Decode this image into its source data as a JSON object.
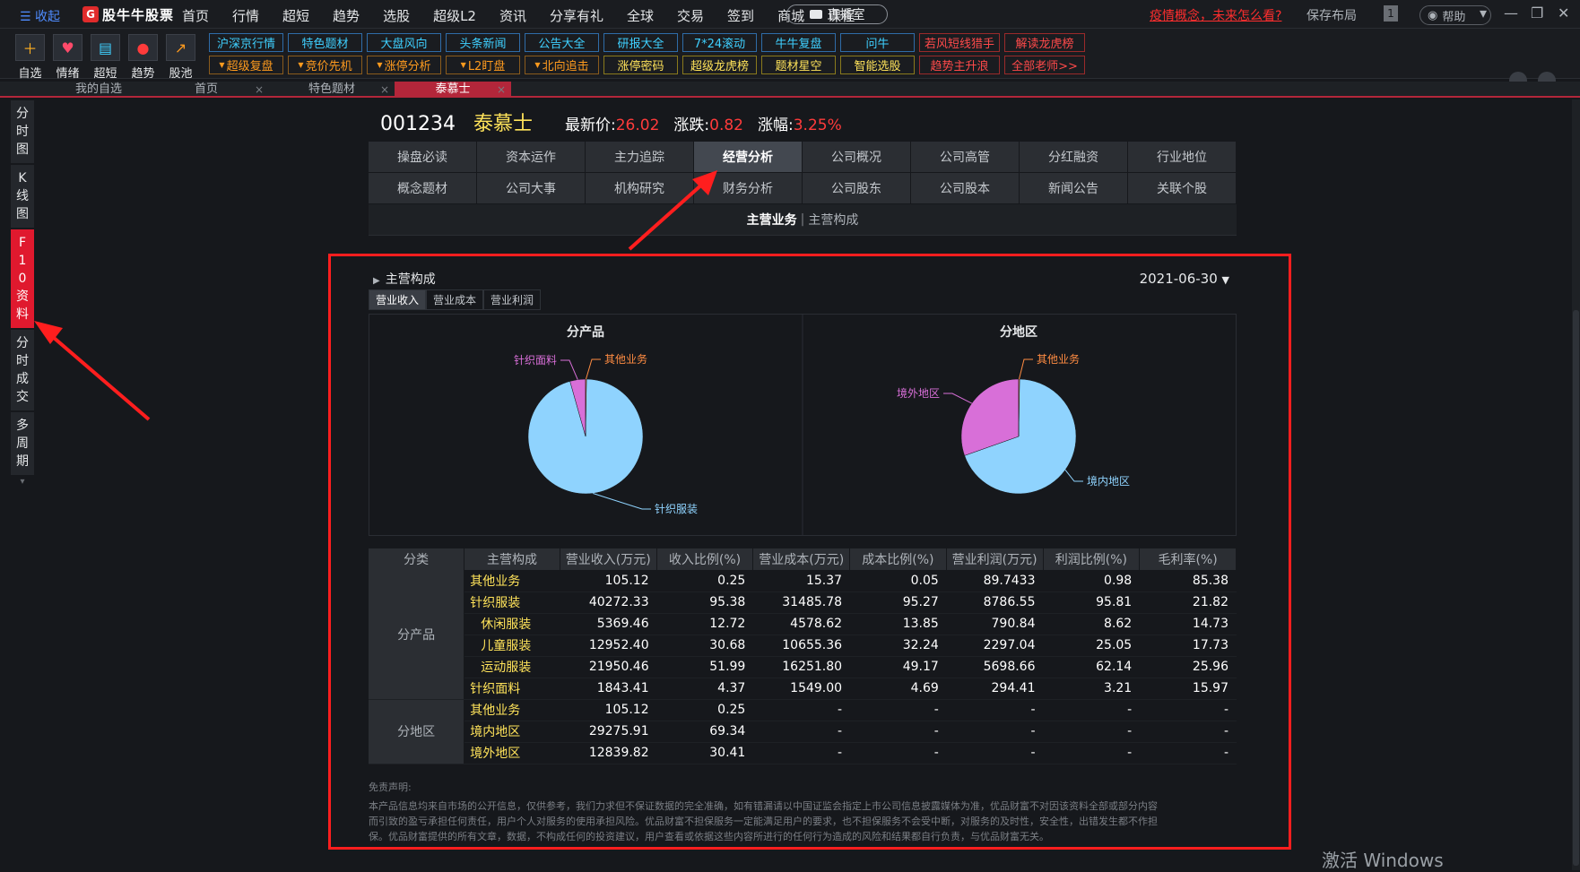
{
  "topbar": {
    "collapse": "收起",
    "logo": "股牛牛股票",
    "nav": [
      "首页",
      "行情",
      "超短",
      "趋势",
      "选股",
      "超级L2",
      "资讯",
      "分享有礼",
      "全球",
      "交易",
      "签到",
      "商城",
      "课程"
    ],
    "live": "直播室",
    "promo": "疫情概念，未来怎么看?",
    "save_layout": "保存布局",
    "window_num": "1",
    "help": "帮助"
  },
  "tools": [
    {
      "label": "自选",
      "icon": "plus-folder-icon"
    },
    {
      "label": "情绪",
      "icon": "heart-icon"
    },
    {
      "label": "超短",
      "icon": "folder-icon"
    },
    {
      "label": "趋势",
      "icon": "target-icon"
    },
    {
      "label": "股池",
      "icon": "chart-icon"
    }
  ],
  "quick_row1": [
    {
      "label": "沪深京行情",
      "style": "cyan"
    },
    {
      "label": "特色题材",
      "style": "cyan"
    },
    {
      "label": "大盘风向",
      "style": "cyan"
    },
    {
      "label": "头条新闻",
      "style": "cyan"
    },
    {
      "label": "公告大全",
      "style": "cyan"
    },
    {
      "label": "研报大全",
      "style": "cyan"
    },
    {
      "label": "7*24滚动",
      "style": "cyan"
    },
    {
      "label": "牛牛复盘",
      "style": "cyan"
    },
    {
      "label": "问牛",
      "style": "cyan"
    },
    {
      "label": "若风短线猎手",
      "style": "red"
    },
    {
      "label": "解读龙虎榜",
      "style": "red"
    }
  ],
  "quick_row2": [
    {
      "label": "超级复盘",
      "style": "orange"
    },
    {
      "label": "竞价先机",
      "style": "orange"
    },
    {
      "label": "涨停分析",
      "style": "orange"
    },
    {
      "label": "L2盯盘",
      "style": "orange"
    },
    {
      "label": "北向追击",
      "style": "orange"
    },
    {
      "label": "涨停密码",
      "style": "yellow"
    },
    {
      "label": "超级龙虎榜",
      "style": "yellow"
    },
    {
      "label": "题材星空",
      "style": "yellow"
    },
    {
      "label": "智能选股",
      "style": "yellow"
    },
    {
      "label": "趋势主升浪",
      "style": "red"
    },
    {
      "label": "全部老师>>",
      "style": "red"
    }
  ],
  "tabs": [
    "我的自选",
    "首页",
    "特色题材",
    "泰慕士"
  ],
  "sidebar": [
    "分时图",
    "K线图",
    "F10资料",
    "分时成交",
    "多周期"
  ],
  "stock": {
    "code": "001234",
    "name": "泰慕士",
    "price_label": "最新价:",
    "price": "26.02",
    "change_label": "涨跌:",
    "change": "0.82",
    "pct_label": "涨幅:",
    "pct": "3.25%"
  },
  "f10_row1": [
    "操盘必读",
    "资本运作",
    "主力追踪",
    "经营分析",
    "公司概况",
    "公司高管",
    "分红融资",
    "行业地位"
  ],
  "f10_row2": [
    "概念题材",
    "公司大事",
    "机构研究",
    "财务分析",
    "公司股东",
    "公司股本",
    "新闻公告",
    "关联个股"
  ],
  "subnav": {
    "active": "主营业务",
    "sep": "|",
    "other": "主营构成"
  },
  "section": {
    "title": "主营构成",
    "date": "2021-06-30"
  },
  "subtabs": [
    "营业收入",
    "营业成本",
    "营业利润"
  ],
  "chart_data": [
    {
      "type": "pie",
      "title": "分产品",
      "labels": [
        "针织服装",
        "针织面料",
        "其他业务"
      ],
      "values": [
        95.38,
        4.37,
        0.25
      ],
      "colors": [
        "#8fd3fe",
        "#d86fd8",
        "#ff8c42"
      ]
    },
    {
      "type": "pie",
      "title": "分地区",
      "labels": [
        "境内地区",
        "境外地区",
        "其他业务"
      ],
      "values": [
        69.34,
        30.41,
        0.25
      ],
      "colors": [
        "#8fd3fe",
        "#d86fd8",
        "#ff8c42"
      ]
    }
  ],
  "table": {
    "headers": [
      "分类",
      "主营构成",
      "营业收入(万元)",
      "收入比例(%)",
      "营业成本(万元)",
      "成本比例(%)",
      "营业利润(万元)",
      "利润比例(%)",
      "毛利率(%)"
    ],
    "groups": [
      {
        "category": "分产品",
        "rows": [
          {
            "name": "其他业务",
            "sub": false,
            "v": [
              "105.12",
              "0.25",
              "15.37",
              "0.05",
              "89.7433",
              "0.98",
              "85.38"
            ]
          },
          {
            "name": "针织服装",
            "sub": false,
            "v": [
              "40272.33",
              "95.38",
              "31485.78",
              "95.27",
              "8786.55",
              "95.81",
              "21.82"
            ]
          },
          {
            "name": "休闲服装",
            "sub": true,
            "v": [
              "5369.46",
              "12.72",
              "4578.62",
              "13.85",
              "790.84",
              "8.62",
              "14.73"
            ]
          },
          {
            "name": "儿童服装",
            "sub": true,
            "v": [
              "12952.40",
              "30.68",
              "10655.36",
              "32.24",
              "2297.04",
              "25.05",
              "17.73"
            ]
          },
          {
            "name": "运动服装",
            "sub": true,
            "v": [
              "21950.46",
              "51.99",
              "16251.80",
              "49.17",
              "5698.66",
              "62.14",
              "25.96"
            ]
          },
          {
            "name": "针织面料",
            "sub": false,
            "v": [
              "1843.41",
              "4.37",
              "1549.00",
              "4.69",
              "294.41",
              "3.21",
              "15.97"
            ]
          }
        ]
      },
      {
        "category": "分地区",
        "rows": [
          {
            "name": "其他业务",
            "sub": false,
            "v": [
              "105.12",
              "0.25",
              "-",
              "-",
              "-",
              "-",
              "-"
            ]
          },
          {
            "name": "境内地区",
            "sub": false,
            "v": [
              "29275.91",
              "69.34",
              "-",
              "-",
              "-",
              "-",
              "-"
            ]
          },
          {
            "name": "境外地区",
            "sub": false,
            "v": [
              "12839.82",
              "30.41",
              "-",
              "-",
              "-",
              "-",
              "-"
            ]
          }
        ]
      }
    ]
  },
  "disclaimer": {
    "title": "免责声明:",
    "line1": "本产品信息均来自市场的公开信息，仅供参考，我们力求但不保证数据的完全准确，如有错漏请以中国证监会指定上市公司信息披露媒体为准，优品财富不对因该资料全部或部分内容",
    "line2": "而引致的盈亏承担任何责任，用户个人对服务的使用承担风险。优品财富不担保服务一定能满足用户的要求，也不担保服务不会受中断，对服务的及时性，安全性，出错发生都不作担",
    "line3": "保。优品财富提供的所有文章，数据，不构成任何的投资建议，用户查看或依据这些内容所进行的任何行为造成的风险和结果都自行负责，与优品财富无关。"
  },
  "watermark": "激活 Windows"
}
